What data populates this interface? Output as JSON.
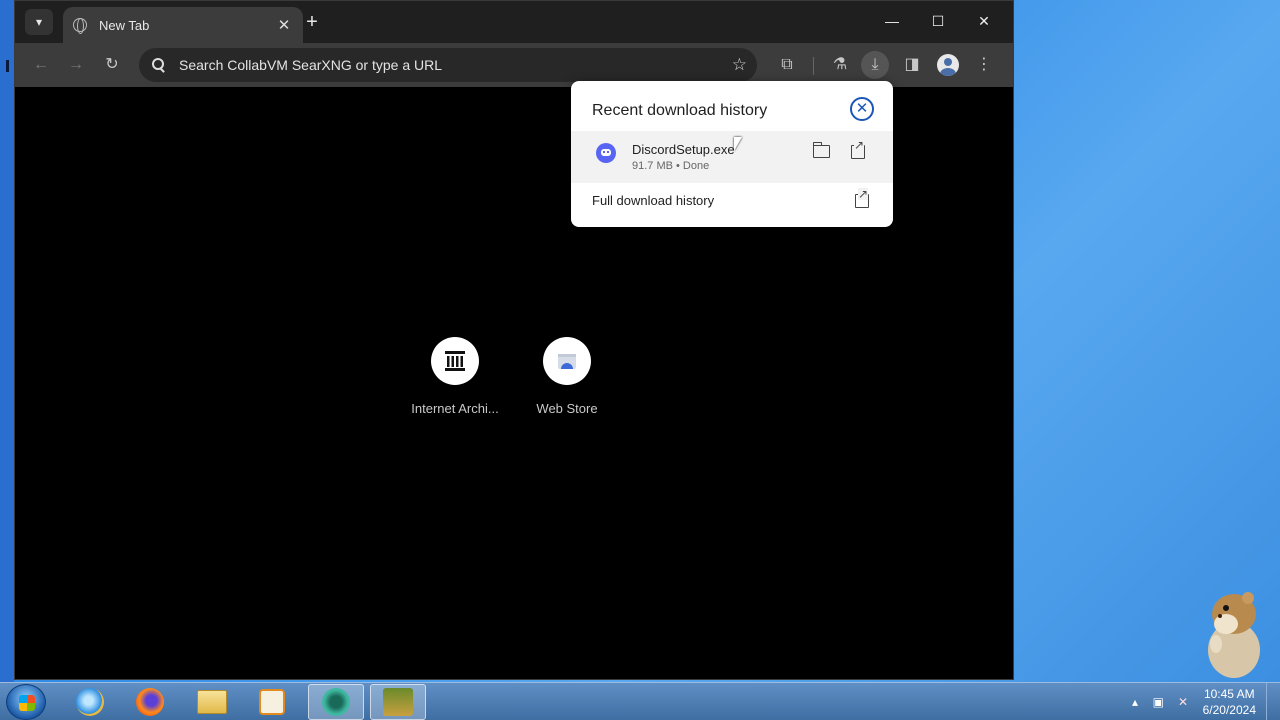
{
  "browser": {
    "tab": {
      "title": "New Tab"
    },
    "omnibox": {
      "placeholder": "Search CollabVM SearXNG or type a URL"
    }
  },
  "shortcuts": [
    {
      "label": "Internet Archi..."
    },
    {
      "label": "Web Store"
    }
  ],
  "downloads": {
    "title": "Recent download history",
    "items": [
      {
        "filename": "DiscordSetup.exe",
        "meta": "91.7 MB • Done"
      }
    ],
    "full_history_label": "Full download history"
  },
  "taskbar": {
    "clock_time": "10:45 AM",
    "clock_date": "6/20/2024"
  },
  "icons": {
    "tab_search": "chevron-down-icon",
    "download": "download-icon",
    "discord": "discord-icon"
  },
  "colors": {
    "accent": "#1a56b8",
    "discord": "#5865f2"
  }
}
